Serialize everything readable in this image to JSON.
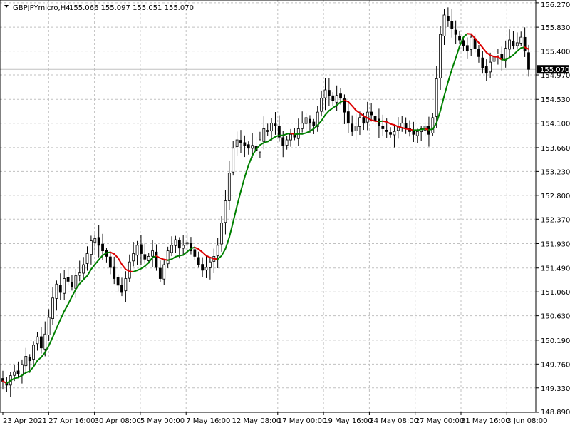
{
  "header": {
    "symbol": "GBPJPYmicro,H4",
    "ohlc": "155.066 155.097 155.051 155.070",
    "dropdown_icon": "triangle-down-icon"
  },
  "colors": {
    "background": "#ffffff",
    "grid": "#c0c0c0",
    "candle": "#000000",
    "ma_up": "#008000",
    "ma_down": "#dc0000",
    "current_price_line": "#c0c0c0",
    "price_badge_bg": "#000000",
    "price_badge_text": "#ffffff"
  },
  "chart_data": {
    "type": "candlestick",
    "grid": true,
    "current_price": 155.07,
    "current_price_label": "155.070",
    "y_range": [
      148.89,
      156.32
    ],
    "y_ticks": [
      "156.270",
      "155.830",
      "155.400",
      "154.970",
      "154.530",
      "154.100",
      "153.660",
      "153.230",
      "152.800",
      "152.370",
      "151.930",
      "151.490",
      "151.060",
      "150.630",
      "150.190",
      "149.760",
      "149.330",
      "148.890"
    ],
    "x_ticks": [
      "23 Apr 2021",
      "27 Apr 16:00",
      "30 Apr 08:00",
      "5 May 00:00",
      "7 May 16:00",
      "12 May 08:00",
      "17 May 00:00",
      "19 May 16:00",
      "24 May 08:00",
      "27 May 00:00",
      "31 May 16:00",
      "3 Jun 08:00"
    ],
    "series": [
      {
        "type": "candlestick",
        "approx_close": [
          149.45,
          149.38,
          149.55,
          149.62,
          149.58,
          149.75,
          149.9,
          149.82,
          150.1,
          150.25,
          150.05,
          150.3,
          150.6,
          150.95,
          151.2,
          151.05,
          151.3,
          151.25,
          151.15,
          151.35,
          151.4,
          151.55,
          151.75,
          151.98,
          152.02,
          151.9,
          151.8,
          151.7,
          151.5,
          151.3,
          151.18,
          151.05,
          151.3,
          151.6,
          151.75,
          151.9,
          151.75,
          151.65,
          151.7,
          151.8,
          151.5,
          151.3,
          151.55,
          151.8,
          151.9,
          152.0,
          151.85,
          151.9,
          151.95,
          151.8,
          151.7,
          151.55,
          151.45,
          151.5,
          151.6,
          151.7,
          151.9,
          152.3,
          152.7,
          153.2,
          153.65,
          153.8,
          153.75,
          153.7,
          153.65,
          153.7,
          153.6,
          153.8,
          154.0,
          153.95,
          154.1,
          154.05,
          153.85,
          153.7,
          153.8,
          153.9,
          153.85,
          154.0,
          154.1,
          154.2,
          154.1,
          154.05,
          154.3,
          154.55,
          154.7,
          154.6,
          154.5,
          154.6,
          154.55,
          154.3,
          154.1,
          153.95,
          154.05,
          154.2,
          154.1,
          154.3,
          154.25,
          154.15,
          154.05,
          154.0,
          153.95,
          153.9,
          153.95,
          154.05,
          154.1,
          154.0,
          153.95,
          153.9,
          153.95,
          154.0,
          154.05,
          153.9,
          154.2,
          154.9,
          155.7,
          156.05,
          155.95,
          155.8,
          155.7,
          155.6,
          155.5,
          155.4,
          155.65,
          155.45,
          155.3,
          155.1,
          155.0,
          155.2,
          155.3,
          155.35,
          155.25,
          155.45,
          155.6,
          155.5,
          155.55,
          155.65,
          155.4,
          155.07
        ]
      },
      {
        "type": "line",
        "style": "moving-average, colored green when rising and red when falling"
      }
    ]
  }
}
